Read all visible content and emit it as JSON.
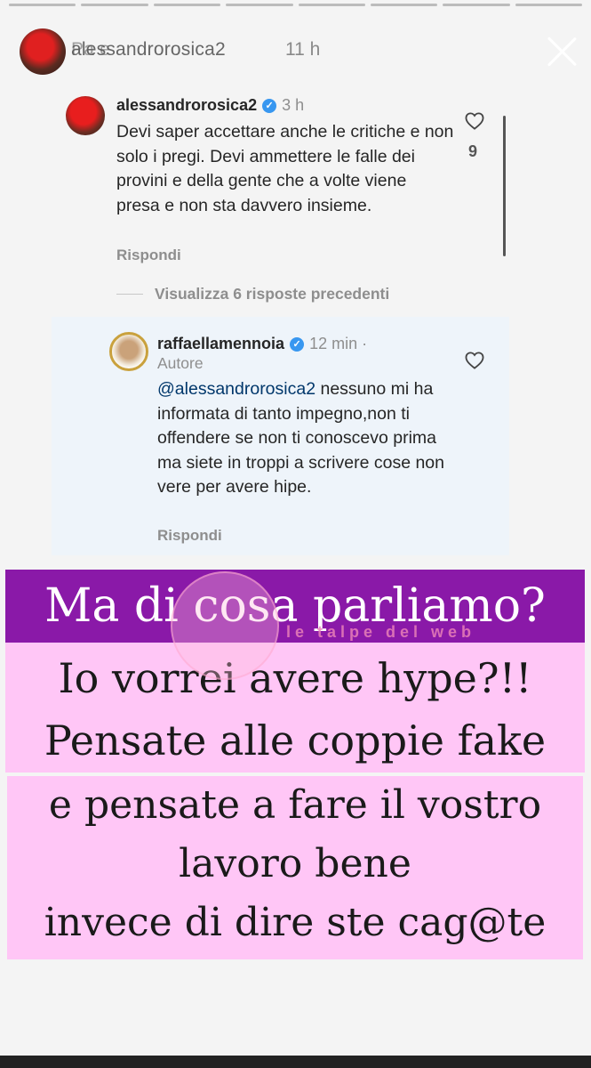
{
  "story": {
    "username": "alessandrorosica2",
    "ghost_text": "Pa    e",
    "time": "11 h"
  },
  "comment1": {
    "username": "alessandrorosica2",
    "time": "3 h",
    "text": "Devi saper accettare anche le critiche e non solo i pregi. Devi ammettere le falle dei provini e della gente che a volte viene presa e non sta davvero insieme.",
    "likes": "9",
    "reply": "Rispondi"
  },
  "view_previous": "Visualizza 6 risposte precedenti",
  "comment2": {
    "username": "raffaellamennoia",
    "time": "12 min ·",
    "role": "Autore",
    "mention": "@alessandrorosica2",
    "text": " nessuno mi ha informata di tanto impegno,non ti offendere se non ti conoscevo prima ma siete in troppi a scrivere cose non vere per avere hipe.",
    "reply": "Rispondi"
  },
  "captions": {
    "line1": "Ma di cosa parliamo?",
    "line2": "Io vorrei avere hype?!!",
    "line3": "Pensate alle coppie fake",
    "line4a": "e pensate a fare il vostro",
    "line4b": "lavoro bene",
    "line4c": "invece di dire ste cag@te"
  },
  "watermark": "le talpe del web",
  "colors": {
    "caption_purple": "#8a19a8",
    "caption_pink": "#ffc6f6",
    "verified_blue": "#3897f0"
  }
}
